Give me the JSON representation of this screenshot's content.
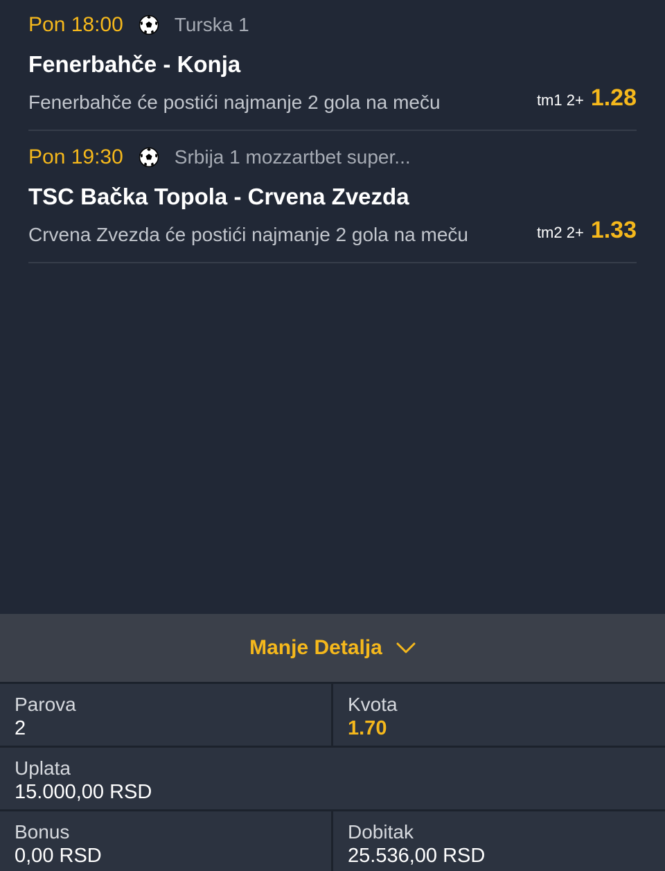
{
  "matches": [
    {
      "time": "Pon 18:00",
      "sport_icon": "soccer-ball-icon",
      "league": "Turska  1",
      "teams": "Fenerbahče - Konja",
      "description": "Fenerbahče će postići najmanje 2 gola na meču",
      "market": "tm1 2+",
      "odd": "1.28"
    },
    {
      "time": "Pon 19:30",
      "sport_icon": "soccer-ball-icon",
      "league": "Srbija 1 mozzartbet super...",
      "teams": "TSC Bačka Topola - Crvena Zvezda",
      "description": "Crvena Zvezda će postići najmanje 2 gola na meču",
      "market": "tm2 2+",
      "odd": "1.33"
    }
  ],
  "details": {
    "toggle_label": "Manje Detalja",
    "pairs_label": "Parova",
    "pairs_value": "2",
    "odds_label": "Kvota",
    "odds_value": "1.70",
    "stake_label": "Uplata",
    "stake_value": "15.000,00 RSD",
    "bonus_label": "Bonus",
    "bonus_value": "0,00 RSD",
    "win_label": "Dobitak",
    "win_value": "25.536,00 RSD"
  },
  "colors": {
    "background": "#212836",
    "accent": "#f5b81c",
    "panel": "#2c3340",
    "toggle_bar": "#3b404a"
  }
}
